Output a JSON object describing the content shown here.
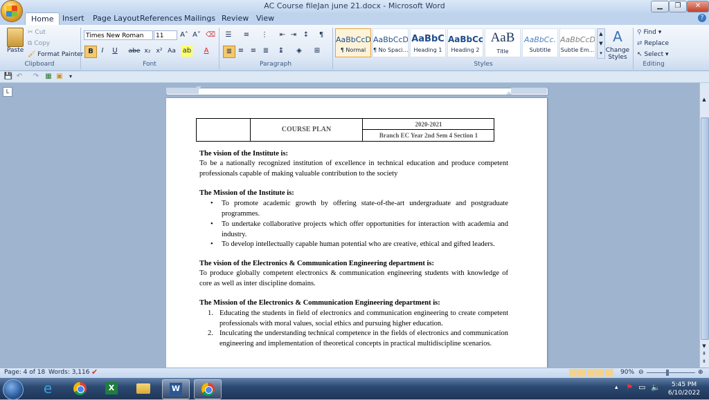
{
  "window": {
    "title": "AC Course fileJan june 21.docx - Microsoft Word",
    "minimize": "▁",
    "restore": "❐",
    "close": "✕"
  },
  "tabs": [
    "Home",
    "Insert",
    "Page Layout",
    "References",
    "Mailings",
    "Review",
    "View"
  ],
  "clipboard": {
    "paste": "Paste",
    "cut": "Cut",
    "copy": "Copy",
    "format_painter": "Format Painter",
    "label": "Clipboard"
  },
  "font": {
    "name": "Times New Roman",
    "size": "11",
    "bold": "B",
    "italic": "I",
    "underline": "U",
    "strike": "abe",
    "subscript": "x₂",
    "superscript": "x²",
    "change_case": "Aa",
    "grow": "A˄",
    "shrink": "A˅",
    "label": "Font"
  },
  "paragraph": {
    "label": "Paragraph",
    "pilcrow": "¶"
  },
  "styles": {
    "label": "Styles",
    "items": [
      {
        "preview": "AaBbCcDc",
        "name": "¶ Normal"
      },
      {
        "preview": "AaBbCcDc",
        "name": "¶ No Spaci..."
      },
      {
        "preview": "AaBbC",
        "name": "Heading 1"
      },
      {
        "preview": "AaBbCc",
        "name": "Heading 2"
      },
      {
        "preview": "AaB",
        "name": "Title"
      },
      {
        "preview": "AaBbCc.",
        "name": "Subtitle"
      },
      {
        "preview": "AaBbCcDc",
        "name": "Subtle Em..."
      }
    ],
    "change_styles": "Change Styles"
  },
  "editing": {
    "label": "Editing",
    "find": "Find",
    "replace": "Replace",
    "select": "Select"
  },
  "document": {
    "table": {
      "course_plan": "COURSE PLAN",
      "year": "2020-2021",
      "branch": "Branch EC Year 2nd Sem 4 Section 1"
    },
    "vision_inst_heading": "The vision of the Institute is:",
    "vision_inst_text": "To be a nationally recognized institution of excellence in technical education and produce competent professionals capable of making valuable contribution to the society",
    "mission_inst_heading": "The Mission of the Institute is:",
    "mission_inst_items": [
      "To promote academic growth by offering state-of-the-art undergraduate and postgraduate programmes.",
      "To undertake collaborative projects which offer opportunities for interaction with academia and industry.",
      "To develop intellectually capable human potential who are creative, ethical and gifted leaders."
    ],
    "vision_dept_heading": "The vision of the Electronics & Communication Engineering department is:",
    "vision_dept_text": "To produce globally competent electronics & communication engineering students with knowledge of core as well as inter discipline domains.",
    "mission_dept_heading": "The Mission of the Electronics & Communication Engineering department is:",
    "mission_dept_items": [
      {
        "num": "1.",
        "text": "Educating the students in field of electronics and communication engineering to create competent professionals with moral values, social ethics and pursuing higher education."
      },
      {
        "num": "2.",
        "text": "Inculcating the understanding technical competence in the fields of electronics and communication engineering and implementation of theoretical concepts in practical multidiscipline scenarios."
      }
    ]
  },
  "status": {
    "page": "Page: 4 of 18",
    "words": "Words: 3,116",
    "zoom": "90%"
  },
  "taskbar": {
    "time": "5:45 PM",
    "date": "6/10/2022"
  }
}
